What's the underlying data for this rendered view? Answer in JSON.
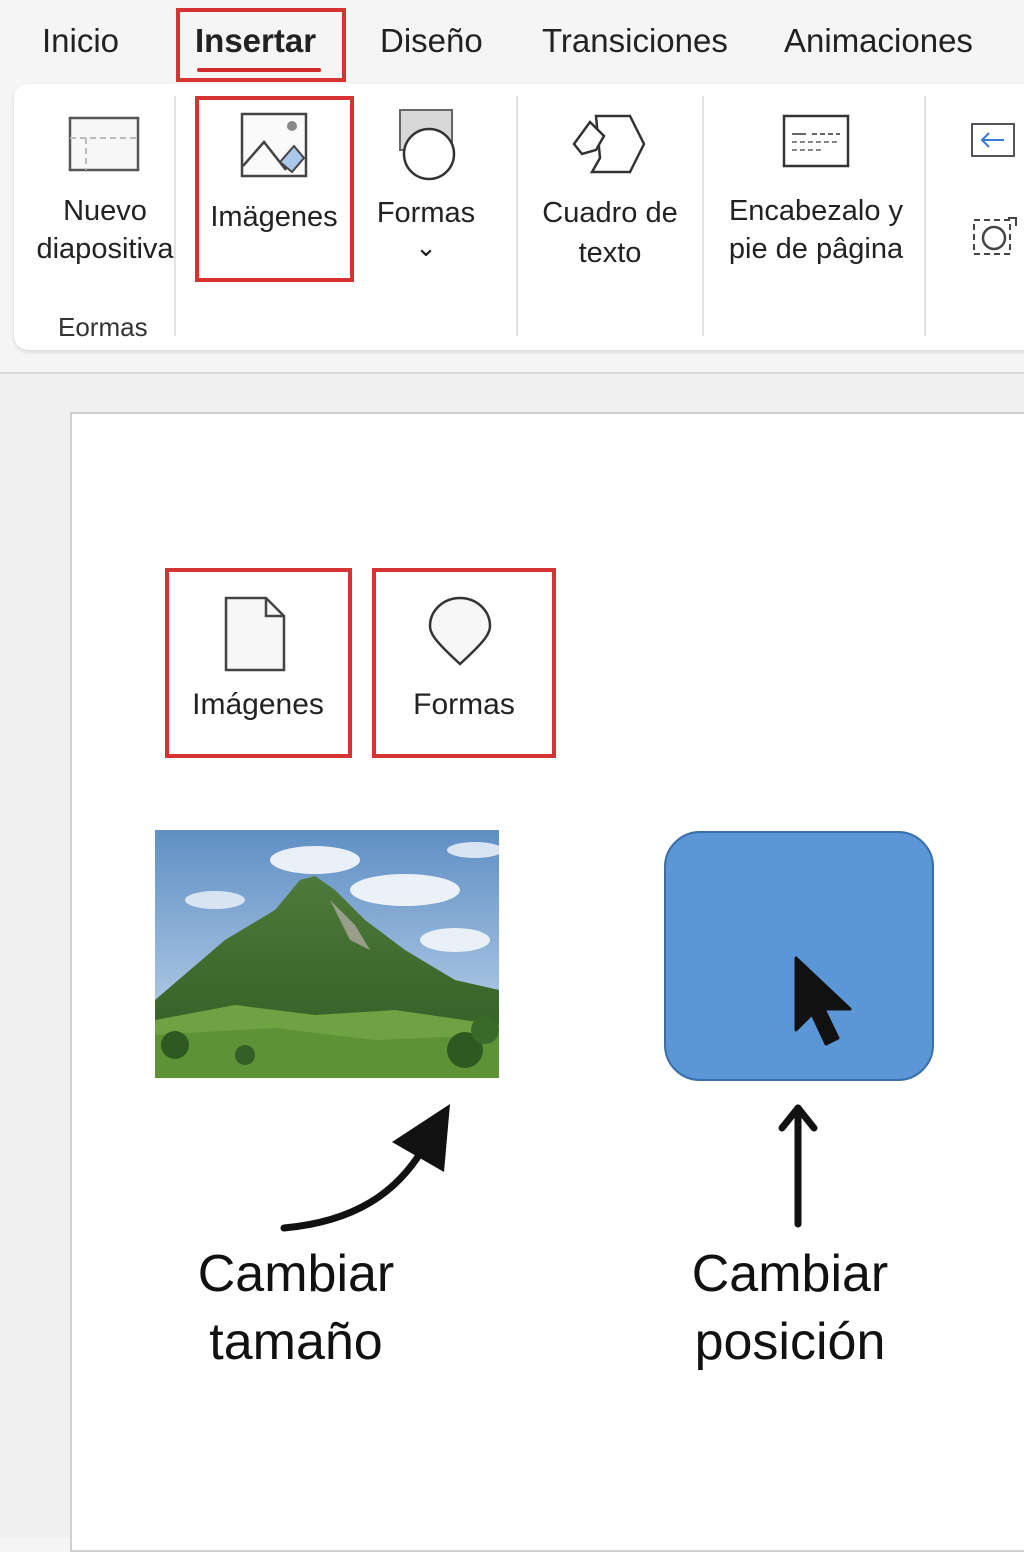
{
  "tabs": [
    {
      "label": "Inicio"
    },
    {
      "label": "Insertar",
      "active": true
    },
    {
      "label": "Diseño"
    },
    {
      "label": "Transiciones"
    },
    {
      "label": "Animaciones"
    }
  ],
  "ribbon": {
    "new_slide": {
      "line1": "Nuevo",
      "line2": "diapositiva",
      "icon": "new-slide-icon"
    },
    "images": {
      "label": "Imägenes",
      "icon": "picture-icon"
    },
    "shapes": {
      "label": "Formas",
      "dropdown": "⌄",
      "icon": "shapes-icon"
    },
    "textbox": {
      "line1": "Cuadro de",
      "line2": "texto",
      "icon": "textbox-icon"
    },
    "header_footer": {
      "line1": "Encabezalo y",
      "line2": "pie de pâgina",
      "icon": "header-footer-icon"
    },
    "group_label": "Eormas"
  },
  "slide": {
    "images_button": {
      "label": "Imágenes",
      "icon": "document-icon"
    },
    "shapes_button": {
      "label": "Formas",
      "icon": "pin-shape-icon"
    },
    "caption_resize": {
      "line1": "Cambiar",
      "line2": "tamaño"
    },
    "caption_move": {
      "line1": "Cambiar",
      "line2": "posición"
    }
  },
  "colors": {
    "highlight": "#d63333",
    "shape_fill": "#5b96d6",
    "shape_border": "#3a6ea8"
  }
}
